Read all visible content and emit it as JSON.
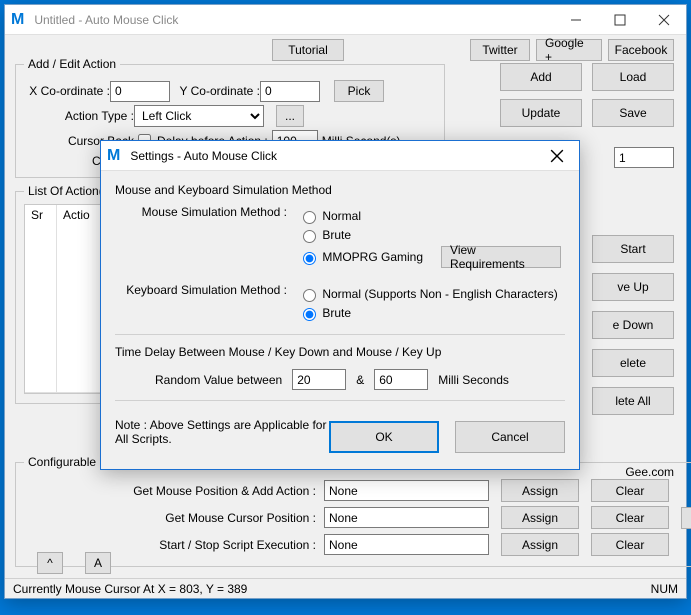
{
  "main": {
    "title": "Untitled - Auto Mouse Click",
    "toplinks": {
      "tutorial": "Tutorial",
      "twitter": "Twitter",
      "google": "Google +",
      "facebook": "Facebook"
    },
    "fieldset_add_edit": "Add / Edit Action",
    "xco_label": "X Co-ordinate :",
    "xco_value": "0",
    "yco_label": "Y Co-ordinate :",
    "yco_value": "0",
    "pick": "Pick",
    "action_type_label": "Action Type :",
    "action_type_value": "Left Click",
    "dots": "...",
    "cursor_back": "Cursor Back",
    "delay_label": "Delay before Action :",
    "delay_value": "100",
    "delay_unit": "Milli Second(s)",
    "comment_label": "Comme",
    "repeat_value": "1 ",
    "btns": {
      "add": "Add",
      "load": "Load",
      "update": "Update",
      "save": "Save"
    },
    "fieldset_list": "List Of Action(",
    "list_headers": [
      "Sr",
      "Actio"
    ],
    "action_right": {
      "start": "Start",
      "moveup": "ve Up",
      "movedown": "e Down",
      "delete": "elete",
      "deleteall": "lete All"
    },
    "gee": "Gee.com",
    "fieldset_cfg": "Configurable G",
    "cfg": {
      "row1_label": "Get Mouse Position & Add Action :",
      "row1_val": "None",
      "row2_label": "Get Mouse Cursor Position :",
      "row2_val": "None",
      "row3_label": "Start / Stop Script Execution :",
      "row3_val": "None",
      "assign": "Assign",
      "clear": "Clear",
      "help": "?"
    },
    "small_up": "^",
    "small_a": "A",
    "status_left": "Currently Mouse Cursor At X = 803, Y = 389",
    "status_num": "NUM"
  },
  "modal": {
    "title": "Settings - Auto Mouse Click",
    "group1": "Mouse and Keyboard Simulation Method",
    "mouse_label": "Mouse Simulation Method :",
    "mouse_opts": [
      "Normal",
      "Brute",
      "MMOPRG Gaming"
    ],
    "view_req": "View Requirements",
    "kbd_label": "Keyboard Simulation Method :",
    "kbd_opts": [
      "Normal (Supports Non - English Characters)",
      "Brute"
    ],
    "delay_title": "Time Delay Between Mouse / Key Down and Mouse / Key Up",
    "rand_label": "Random Value between",
    "rand_min": "20",
    "amp": "&",
    "rand_max": "60",
    "rand_unit": "Milli Seconds",
    "note": "Note : Above Settings are Applicable for All Scripts.",
    "ok": "OK",
    "cancel": "Cancel"
  }
}
